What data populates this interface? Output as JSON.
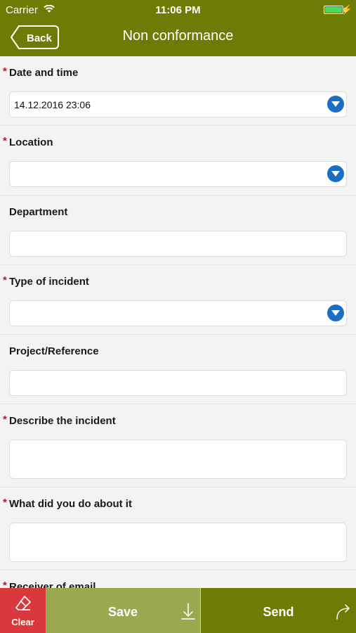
{
  "status_bar": {
    "carrier": "Carrier",
    "time": "11:06 PM",
    "battery_level": 1.0
  },
  "nav": {
    "back_label": "Back",
    "title": "Non conformance"
  },
  "colors": {
    "brand": "#6e7c05",
    "save": "#9aa84f",
    "clear": "#d9393d",
    "required": "#c8102e",
    "dropdown_icon": "#1a6fc4"
  },
  "form": {
    "date_time": {
      "label": "Date and time",
      "required": true,
      "value": "14.12.2016 23:06",
      "icon": "chevron-down-icon"
    },
    "location": {
      "label": "Location",
      "required": true,
      "value": "",
      "icon": "chevron-down-icon"
    },
    "department": {
      "label": "Department",
      "required": false,
      "value": ""
    },
    "type_of_incident": {
      "label": "Type of incident",
      "required": true,
      "value": "",
      "icon": "chevron-down-icon"
    },
    "project_reference": {
      "label": "Project/Reference",
      "required": false,
      "value": ""
    },
    "describe_incident": {
      "label": "Describe the incident",
      "required": true,
      "value": ""
    },
    "what_did_you_do": {
      "label": "What did you do about it",
      "required": true,
      "value": ""
    },
    "receiver_of_email": {
      "label": "Receiver of email",
      "required": true
    }
  },
  "toolbar": {
    "clear_label": "Clear",
    "save_label": "Save",
    "send_label": "Send"
  },
  "required_marker": "*"
}
